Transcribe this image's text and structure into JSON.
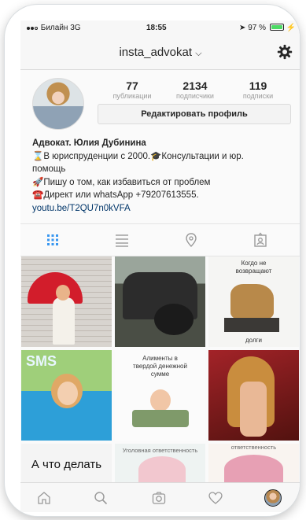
{
  "status_bar": {
    "carrier": "Билайн",
    "network": "3G",
    "time": "18:55",
    "battery": "97 %",
    "battery_level": 0.97
  },
  "header": {
    "username": "insta_advokat",
    "dropdown_icon": "chevron-down-icon",
    "settings_icon": "gear-icon"
  },
  "profile": {
    "stats": [
      {
        "num": "77",
        "label": "публикации"
      },
      {
        "num": "2134",
        "label": "подписчики"
      },
      {
        "num": "119",
        "label": "подписки"
      }
    ],
    "edit_button": "Редактировать профиль",
    "name": "Адвокат. Юлия Дубинина",
    "bio_lines": [
      "⌛В юриспруденции с 2000.🎓Консультации и юр.",
      "помощь",
      "🚀Пишу о том, как избавиться от проблем",
      "☎️Директ или whatsApp +79207613555."
    ],
    "link": "youtu.be/T2QU7n0kVFA"
  },
  "tabs": [
    "grid-icon",
    "list-icon",
    "location-pin-icon",
    "tagged-icon"
  ],
  "grid_captions": {
    "c3": [
      "Когдо не",
      "возвращают"
    ],
    "c3b": "долги",
    "c4": "SMS",
    "c5": [
      "Алименты в",
      "твердой денежной",
      "сумме"
    ],
    "c7": "А что делать",
    "c8": "Уголовная ответственность",
    "c9": "ответственность"
  },
  "bottom_bar": [
    "home-icon",
    "search-icon",
    "camera-icon",
    "heart-icon",
    "profile-avatar"
  ]
}
